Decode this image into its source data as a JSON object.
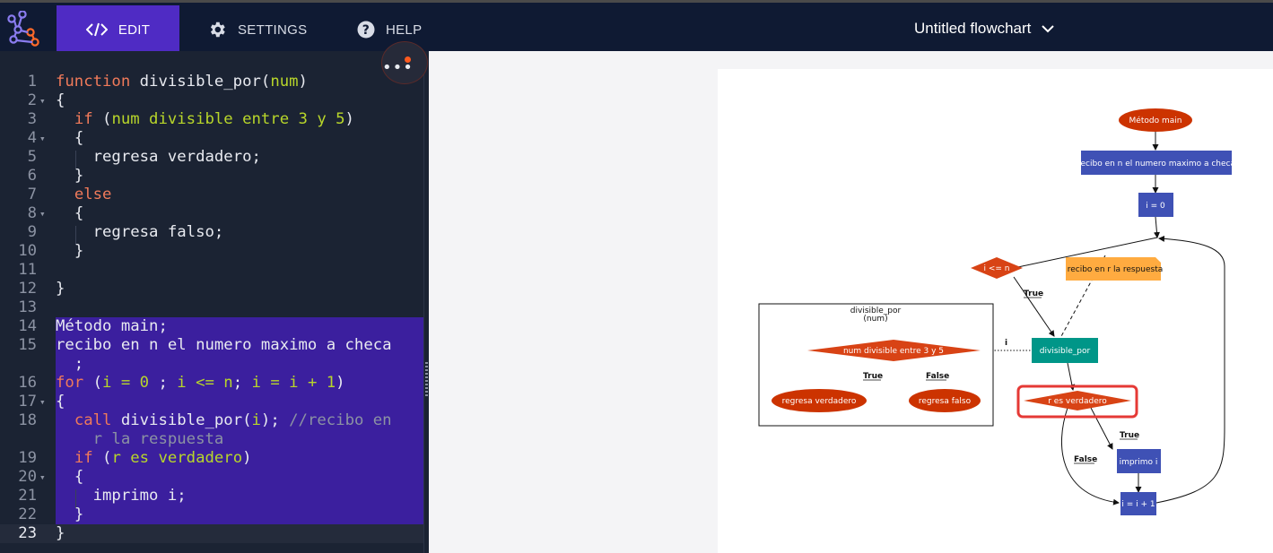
{
  "app": {
    "tabs": [
      {
        "label": "EDIT",
        "icon": "code-icon"
      },
      {
        "label": "SETTINGS",
        "icon": "gear-icon"
      },
      {
        "label": "HELP",
        "icon": "help-icon"
      }
    ],
    "document_title": "Untitled flowchart",
    "colors": {
      "topbar": "#0f1a33",
      "active_tab": "#4f2bc4",
      "editor_bg": "#1b2333",
      "selection": "#3b1f9e",
      "keyword": "#f07a5a",
      "identifier": "#b8d62a",
      "terminal_node": "#cc3300",
      "process_node": "#3f51b5",
      "decision_node": "#d84315",
      "call_node": "#009688",
      "comment_node": "#ffab40",
      "highlight": "#e53935"
    }
  },
  "editor": {
    "lines": [
      {
        "n": "1",
        "fold": false
      },
      {
        "n": "2",
        "fold": true
      },
      {
        "n": "3",
        "fold": false
      },
      {
        "n": "4",
        "fold": true
      },
      {
        "n": "5",
        "fold": false
      },
      {
        "n": "6",
        "fold": false
      },
      {
        "n": "7",
        "fold": false
      },
      {
        "n": "8",
        "fold": true
      },
      {
        "n": "9",
        "fold": false
      },
      {
        "n": "10",
        "fold": false
      },
      {
        "n": "11",
        "fold": false
      },
      {
        "n": "12",
        "fold": false
      },
      {
        "n": "13",
        "fold": false
      },
      {
        "n": "14",
        "fold": false
      },
      {
        "n": "15",
        "fold": false
      },
      {
        "n": "",
        "fold": false
      },
      {
        "n": "16",
        "fold": false
      },
      {
        "n": "17",
        "fold": true
      },
      {
        "n": "18",
        "fold": false
      },
      {
        "n": "",
        "fold": false
      },
      {
        "n": "19",
        "fold": false
      },
      {
        "n": "20",
        "fold": true
      },
      {
        "n": "21",
        "fold": false
      },
      {
        "n": "22",
        "fold": false
      },
      {
        "n": "23",
        "fold": false
      }
    ],
    "code": {
      "l1": [
        "function",
        " divisible_por(",
        "num",
        ")"
      ],
      "l2": "{",
      "l3": [
        "if",
        " (",
        "num divisible entre 3 y 5",
        ")"
      ],
      "l4": "{",
      "l5": "regresa verdadero;",
      "l6": "}",
      "l7": "else",
      "l8": "{",
      "l9": "regresa falso;",
      "l10": "}",
      "l12": "}",
      "l14": "Método main;",
      "l15a": "recibo en n el numero maximo a checa",
      "l15b": "  ;",
      "l16": [
        "for",
        " (",
        "i = 0",
        " ; ",
        "i <= n",
        "; ",
        "i = i + 1",
        ")"
      ],
      "l17": "{",
      "l18a": [
        "call",
        " divisible_por(",
        "i",
        "); ",
        "//recibo en"
      ],
      "l18b": "r la respuesta",
      "l19": [
        "if",
        " (",
        "r es verdadero",
        ")"
      ],
      "l20": "{",
      "l21": "imprimo i;",
      "l22": "}",
      "l23": "}"
    }
  },
  "flowchart": {
    "nodes": {
      "main": "Método main",
      "read_n": "recibo en n el numero maximo a checa",
      "init_i": "i = 0",
      "cond_loop": "i <= n",
      "comment": "recibo en r la respuesta",
      "call": "divisible_por",
      "cond_r": "r es verdadero",
      "print": "imprimo i",
      "incr": "i = i + 1",
      "sub_title_1": "divisible_por",
      "sub_title_2": "(num)",
      "sub_cond": "num divisible entre 3 y 5",
      "sub_true": "regresa verdadero",
      "sub_false": "regresa falso"
    },
    "edge_labels": {
      "loop_true": "True",
      "r_true": "True",
      "r_false": "False",
      "sub_true": "True",
      "sub_false": "False",
      "call_arg": "i"
    }
  }
}
